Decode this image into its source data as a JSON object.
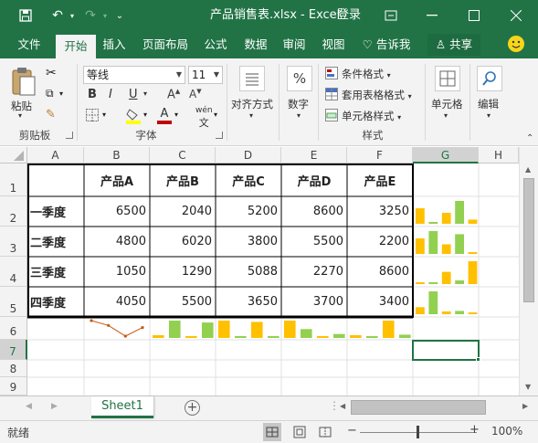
{
  "window": {
    "title": "产品销售表.xlsx - Excel",
    "login": "登录"
  },
  "menu": {
    "tabs": [
      "文件",
      "开始",
      "插入",
      "页面布局",
      "公式",
      "数据",
      "审阅",
      "视图"
    ],
    "tell_me": "告诉我",
    "share": "共享"
  },
  "ribbon": {
    "clipboard": {
      "paste": "粘贴",
      "label": "剪贴板"
    },
    "font": {
      "name": "等线",
      "size": "11",
      "label": "字体",
      "bold": "B",
      "italic": "I",
      "underline": "U",
      "wen": "wén"
    },
    "alignment": {
      "label": "对齐方式"
    },
    "number": {
      "label": "数字",
      "symbol": "%"
    },
    "styles": {
      "conditional": "条件格式",
      "table": "套用表格格式",
      "cell": "单元格样式",
      "label": "样式"
    },
    "cells": {
      "label": "单元格"
    },
    "editing": {
      "label": "编辑"
    }
  },
  "grid": {
    "columns": [
      "A",
      "B",
      "C",
      "D",
      "E",
      "F",
      "G",
      "H"
    ],
    "rows": [
      "1",
      "2",
      "3",
      "4",
      "5",
      "6",
      "7",
      "8",
      "9"
    ],
    "header": [
      "产品A",
      "产品B",
      "产品C",
      "产品D",
      "产品E"
    ],
    "quarters": [
      "一季度",
      "二季度",
      "三季度",
      "四季度"
    ],
    "values": [
      [
        "6500",
        "2040",
        "5200",
        "8600",
        "3250"
      ],
      [
        "4800",
        "6020",
        "3800",
        "5500",
        "2200"
      ],
      [
        "1050",
        "1290",
        "5088",
        "2270",
        "8600"
      ],
      [
        "4050",
        "5500",
        "3650",
        "3700",
        "3400"
      ]
    ]
  },
  "chart_data": {
    "type": "bar",
    "categories": [
      "产品A",
      "产品B",
      "产品C",
      "产品D",
      "产品E"
    ],
    "series": [
      {
        "name": "一季度",
        "values": [
          6500,
          2040,
          5200,
          8600,
          3250
        ]
      },
      {
        "name": "二季度",
        "values": [
          4800,
          6020,
          3800,
          5500,
          2200
        ]
      },
      {
        "name": "三季度",
        "values": [
          1050,
          1290,
          5088,
          2270,
          8600
        ]
      },
      {
        "name": "四季度",
        "values": [
          4050,
          5500,
          3650,
          3700,
          3400
        ]
      }
    ],
    "column_sparklines": {
      "types": [
        "line",
        "column",
        "column",
        "column",
        "column"
      ]
    },
    "colors": {
      "high": "#ffc000",
      "mid": "#92d050",
      "line": "#c55a11"
    }
  },
  "sheet": {
    "tab": "Sheet1"
  },
  "status": {
    "ready": "就绪",
    "zoom": "100%"
  }
}
